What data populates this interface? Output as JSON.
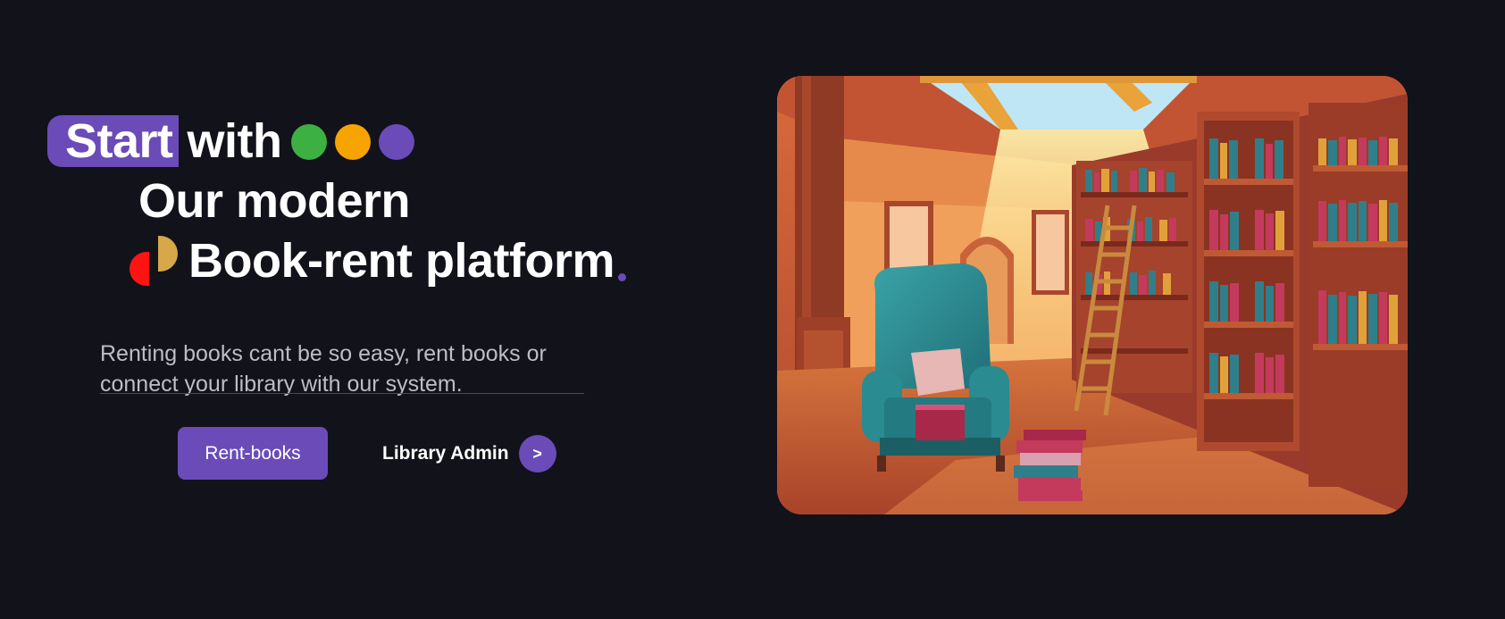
{
  "hero": {
    "start_word": "Start",
    "with_word": "with",
    "line2": "Our modern",
    "line3": "Book-rent platform",
    "subtitle": "Renting books cant be so easy, rent books or connect your library with our system.",
    "rent_button_label": "Rent-books",
    "admin_link_label": "Library Admin",
    "admin_arrow": ">"
  },
  "colors": {
    "background": "#12121a",
    "accent_purple": "#6a4bb8",
    "dot_green": "#3cb043",
    "dot_orange": "#f7a300",
    "dot_purple": "#6a4bb8",
    "logo_red": "#ff1313",
    "logo_gold": "#d6a84a"
  }
}
